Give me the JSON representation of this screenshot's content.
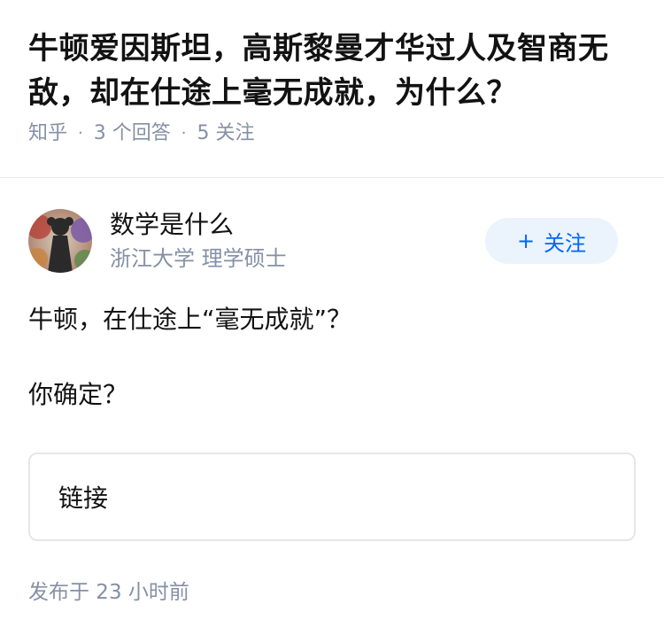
{
  "question": {
    "title": "牛顿爱因斯坦，高斯黎曼才华过人及智商无敌，却在仕途上毫无成就，为什么？",
    "source": "知乎",
    "answer_count": "3 个回答",
    "follower_count": "5 关注"
  },
  "answer": {
    "author": {
      "name": "数学是什么",
      "headline": "浙江大学 理学硕士",
      "follow_label": "关注",
      "follow_icon": "plus-icon"
    },
    "paragraphs": [
      "牛顿，在仕途上“毫无成就”？",
      "你确定？"
    ],
    "link_card_label": "链接",
    "publish_time": "发布于 23 小时前"
  },
  "colors": {
    "accent": "#0066ff",
    "follow_bg": "#ebf3fd",
    "meta_text": "#8590a6",
    "divider": "#ebebeb"
  }
}
